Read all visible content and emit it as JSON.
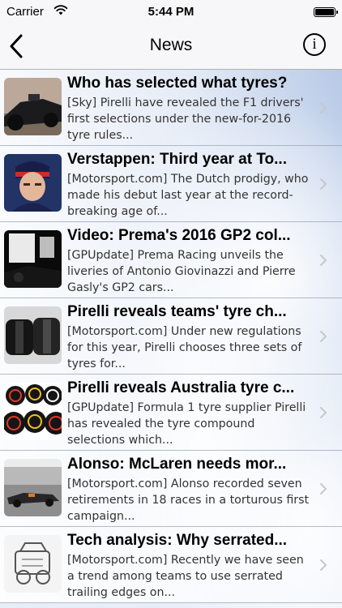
{
  "status_bar": {
    "carrier": "Carrier",
    "time": "5:44 PM"
  },
  "nav": {
    "title": "News",
    "info_label": "i"
  },
  "news": [
    {
      "title": "Who has selected what tyres?",
      "summary": "[Sky] Pirelli have revealed the F1 drivers' first selections under the new-for-2016 tyre rules..."
    },
    {
      "title": "Verstappen: Third year at To...",
      "summary": "[Motorsport.com] The Dutch prodigy, who made his debut last year at the record-breaking age of..."
    },
    {
      "title": "Video: Prema's 2016 GP2 col...",
      "summary": "[GPUpdate] Prema Racing unveils the liveries of Antonio Giovinazzi and Pierre Gasly's GP2 cars..."
    },
    {
      "title": "Pirelli reveals teams' tyre ch...",
      "summary": "[Motorsport.com] Under new regulations for this year, Pirelli chooses three sets of tyres for..."
    },
    {
      "title": "Pirelli reveals Australia tyre c...",
      "summary": "[GPUpdate] Formula 1 tyre supplier Pirelli has revealed the tyre compound selections which..."
    },
    {
      "title": "Alonso: McLaren needs mor...",
      "summary": "[Motorsport.com] Alonso recorded seven retirements in 18 races in a torturous first campaign..."
    },
    {
      "title": "Tech analysis: Why serrated...",
      "summary": "[Motorsport.com] Recently we have seen a trend among teams to use serrated trailing edges on..."
    }
  ]
}
